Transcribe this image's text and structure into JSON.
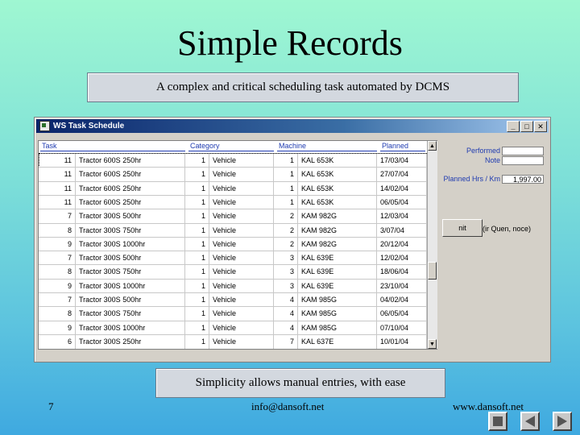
{
  "slide": {
    "title": "Simple Records",
    "subtitle": "A complex and critical scheduling task automated by DCMS",
    "caption": "Simplicity allows manual entries, with ease",
    "page_number": "7",
    "email": "info@dansoft.net",
    "website": "www.dansoft.net"
  },
  "window": {
    "title": "WS Task Schedule",
    "buttons": {
      "minimize": "_",
      "maximize": "□",
      "close": "✕"
    }
  },
  "table": {
    "headers": {
      "task": "Task",
      "category": "Category",
      "machine": "Machine",
      "planned": "Planned"
    },
    "rows": [
      {
        "tnum": "11",
        "tname": "Tractor 600S  250hr",
        "cnum": "1",
        "cname": "Vehicle",
        "mnum": "1",
        "mname": "KAL 653K",
        "planned": "17/03/04"
      },
      {
        "tnum": "11",
        "tname": "Tractor 600S  250hr",
        "cnum": "1",
        "cname": "Vehicle",
        "mnum": "1",
        "mname": "KAL 653K",
        "planned": "27/07/04"
      },
      {
        "tnum": "11",
        "tname": "Tractor 600S  250hr",
        "cnum": "1",
        "cname": "Vehicle",
        "mnum": "1",
        "mname": "KAL 653K",
        "planned": "14/02/04"
      },
      {
        "tnum": "11",
        "tname": "Tractor 600S  250hr",
        "cnum": "1",
        "cname": "Vehicle",
        "mnum": "1",
        "mname": "KAL 653K",
        "planned": "06/05/04"
      },
      {
        "tnum": "7",
        "tname": "Tractor 300S  500hr",
        "cnum": "1",
        "cname": "Vehicle",
        "mnum": "2",
        "mname": "KAM 982G",
        "planned": "12/03/04"
      },
      {
        "tnum": "8",
        "tname": "Tractor 300S  750hr",
        "cnum": "1",
        "cname": "Vehicle",
        "mnum": "2",
        "mname": "KAM 982G",
        "planned": "3/07/04"
      },
      {
        "tnum": "9",
        "tname": "Tractor 300S  1000hr",
        "cnum": "1",
        "cname": "Vehicle",
        "mnum": "2",
        "mname": "KAM 982G",
        "planned": "20/12/04"
      },
      {
        "tnum": "7",
        "tname": "Tractor 300S  500hr",
        "cnum": "1",
        "cname": "Vehicle",
        "mnum": "3",
        "mname": "KAL 639E",
        "planned": "12/02/04"
      },
      {
        "tnum": "8",
        "tname": "Tractor 300S  750hr",
        "cnum": "1",
        "cname": "Vehicle",
        "mnum": "3",
        "mname": "KAL 639E",
        "planned": "18/06/04"
      },
      {
        "tnum": "9",
        "tname": "Tractor 300S  1000hr",
        "cnum": "1",
        "cname": "Vehicle",
        "mnum": "3",
        "mname": "KAL 639E",
        "planned": "23/10/04"
      },
      {
        "tnum": "7",
        "tname": "Tractor 300S  500hr",
        "cnum": "1",
        "cname": "Vehicle",
        "mnum": "4",
        "mname": "KAM 985G",
        "planned": "04/02/04"
      },
      {
        "tnum": "8",
        "tname": "Tractor 300S  750hr",
        "cnum": "1",
        "cname": "Vehicle",
        "mnum": "4",
        "mname": "KAM 985G",
        "planned": "06/05/04"
      },
      {
        "tnum": "9",
        "tname": "Tractor 300S  1000hr",
        "cnum": "1",
        "cname": "Vehicle",
        "mnum": "4",
        "mname": "KAM 985G",
        "planned": "07/10/04"
      },
      {
        "tnum": "6",
        "tname": "Tractor 300S  250hr",
        "cnum": "1",
        "cname": "Vehicle",
        "mnum": "7",
        "mname": "KAL 637E",
        "planned": "10/01/04"
      }
    ]
  },
  "right_panel": {
    "performed_label": "Performed",
    "note_label": "Note",
    "planned_hrs_label": "Planned Hrs / Km",
    "planned_hrs_value": "1,997.00",
    "button_label": "nit",
    "button_note": "(ir Quen, noce)"
  },
  "nav": {
    "icons": [
      "stop-icon",
      "previous-icon",
      "next-icon"
    ]
  }
}
